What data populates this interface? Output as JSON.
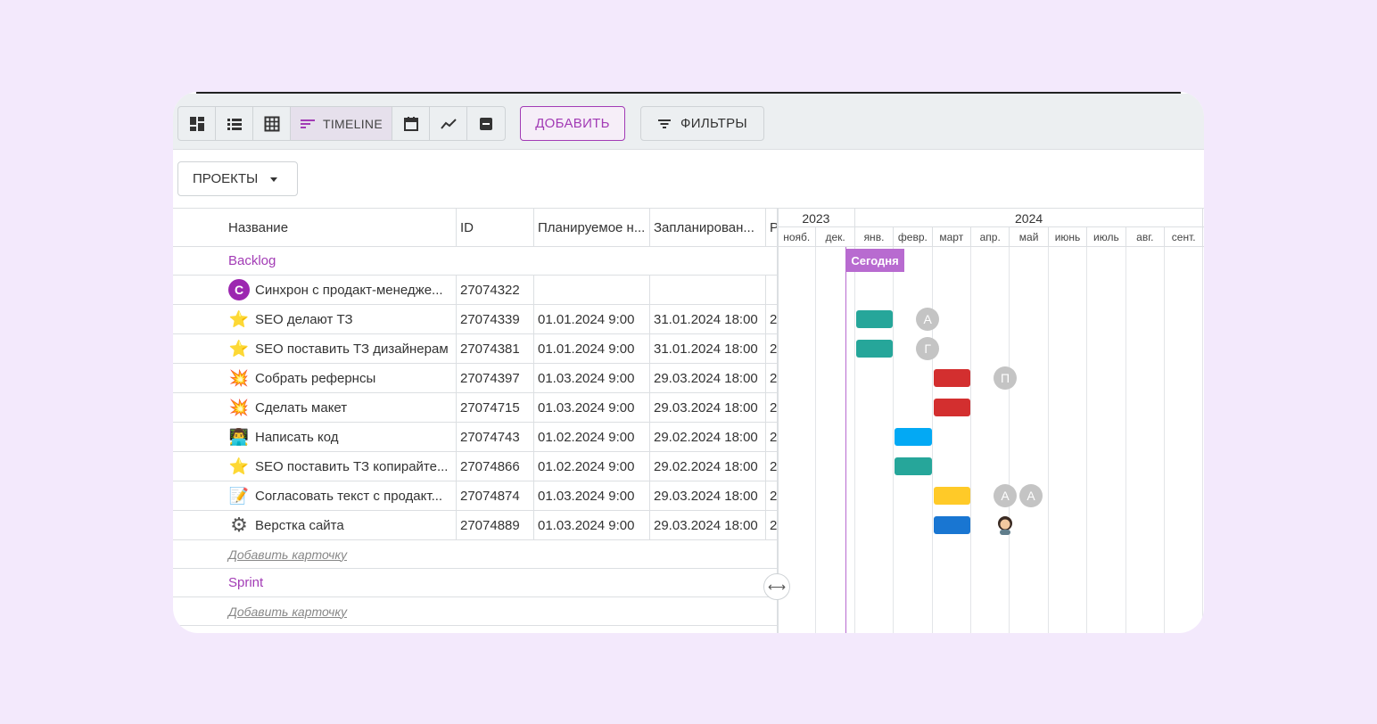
{
  "toolbar": {
    "views": [
      {
        "icon": "dashboard-icon"
      },
      {
        "icon": "list-icon"
      },
      {
        "icon": "grid-icon"
      },
      {
        "icon": "timeline-icon",
        "label": "TIMELINE",
        "active": true
      },
      {
        "icon": "calendar-icon"
      },
      {
        "icon": "chart-line-icon"
      },
      {
        "icon": "archive-icon"
      }
    ],
    "add_label": "ДОБАВИТЬ",
    "filters_label": "ФИЛЬТРЫ"
  },
  "projects_label": "ПРОЕКТЫ",
  "table": {
    "headers": {
      "name": "Название",
      "id": "ID",
      "start": "Планируемое н...",
      "end": "Запланирован...",
      "r": "P"
    },
    "sections": [
      {
        "title": "Backlog",
        "rows": [
          {
            "icon": "avatar-c",
            "avatar_letter": "С",
            "name": "Синхрон с продакт-менедже...",
            "id": "27074322",
            "start": "",
            "end": "",
            "r": ""
          },
          {
            "icon": "star",
            "glyph": "⭐",
            "name": "SEO делают ТЗ",
            "id": "27074339",
            "start": "01.01.2024 9:00",
            "end": "31.01.2024 18:00",
            "r": "2"
          },
          {
            "icon": "star",
            "glyph": "⭐",
            "name": "SEO поставить ТЗ дизайнерам",
            "id": "27074381",
            "start": "01.01.2024 9:00",
            "end": "31.01.2024 18:00",
            "r": "2"
          },
          {
            "icon": "boom",
            "glyph": "💥",
            "name": "Собрать рефернсы",
            "id": "27074397",
            "start": "01.03.2024 9:00",
            "end": "29.03.2024 18:00",
            "r": "2"
          },
          {
            "icon": "boom",
            "glyph": "💥",
            "name": "Сделать макет",
            "id": "27074715",
            "start": "01.03.2024 9:00",
            "end": "29.03.2024 18:00",
            "r": "2"
          },
          {
            "icon": "technologist",
            "glyph": "👨‍💻",
            "name": "Написать код",
            "id": "27074743",
            "start": "01.02.2024 9:00",
            "end": "29.02.2024 18:00",
            "r": "2"
          },
          {
            "icon": "star",
            "glyph": "⭐",
            "name": "SEO поставить ТЗ копирайте...",
            "id": "27074866",
            "start": "01.02.2024 9:00",
            "end": "29.02.2024 18:00",
            "r": "2"
          },
          {
            "icon": "memo",
            "glyph": "📝",
            "name": "Согласовать текст с продакт...",
            "id": "27074874",
            "start": "01.03.2024 9:00",
            "end": "29.03.2024 18:00",
            "r": "2"
          },
          {
            "icon": "gear",
            "glyph": "⚙",
            "name": "Верстка сайта",
            "id": "27074889",
            "start": "01.03.2024 9:00",
            "end": "29.03.2024 18:00",
            "r": "2"
          }
        ],
        "add_card": "Добавить карточку"
      },
      {
        "title": "Sprint",
        "rows": [],
        "add_card": "Добавить карточку"
      }
    ]
  },
  "gantt": {
    "years": [
      {
        "label": "2023"
      },
      {
        "label": "2024"
      }
    ],
    "months": [
      "нояб.",
      "дек.",
      "янв.",
      "февр.",
      "март",
      "апр.",
      "май",
      "июнь",
      "июль",
      "авг.",
      "сент."
    ],
    "today_label": "Сегодня",
    "bars": [
      {
        "row": 1,
        "start_month": "янв.",
        "end_month": "янв.",
        "color": "#26a69a",
        "avatars": [
          "А"
        ]
      },
      {
        "row": 2,
        "start_month": "янв.",
        "end_month": "янв.",
        "color": "#26a69a",
        "avatars": [
          "Г"
        ]
      },
      {
        "row": 3,
        "start_month": "март",
        "end_month": "март",
        "color": "#d32f2f",
        "avatars": [
          "П"
        ]
      },
      {
        "row": 4,
        "start_month": "март",
        "end_month": "март",
        "color": "#d32f2f",
        "avatars": []
      },
      {
        "row": 5,
        "start_month": "февр.",
        "end_month": "февр.",
        "color": "#03a9f4",
        "avatars": []
      },
      {
        "row": 6,
        "start_month": "февр.",
        "end_month": "февр.",
        "color": "#26a69a",
        "avatars": []
      },
      {
        "row": 7,
        "start_month": "март",
        "end_month": "март",
        "color": "#ffca28",
        "avatars": [
          "А",
          "А"
        ]
      },
      {
        "row": 8,
        "start_month": "март",
        "end_month": "март",
        "color": "#1976d2",
        "avatars": [
          "woman-avatar"
        ]
      }
    ]
  },
  "colors": {
    "accent": "#a23bb5",
    "today": "#b86bd0",
    "background": "#f3e9fc"
  }
}
